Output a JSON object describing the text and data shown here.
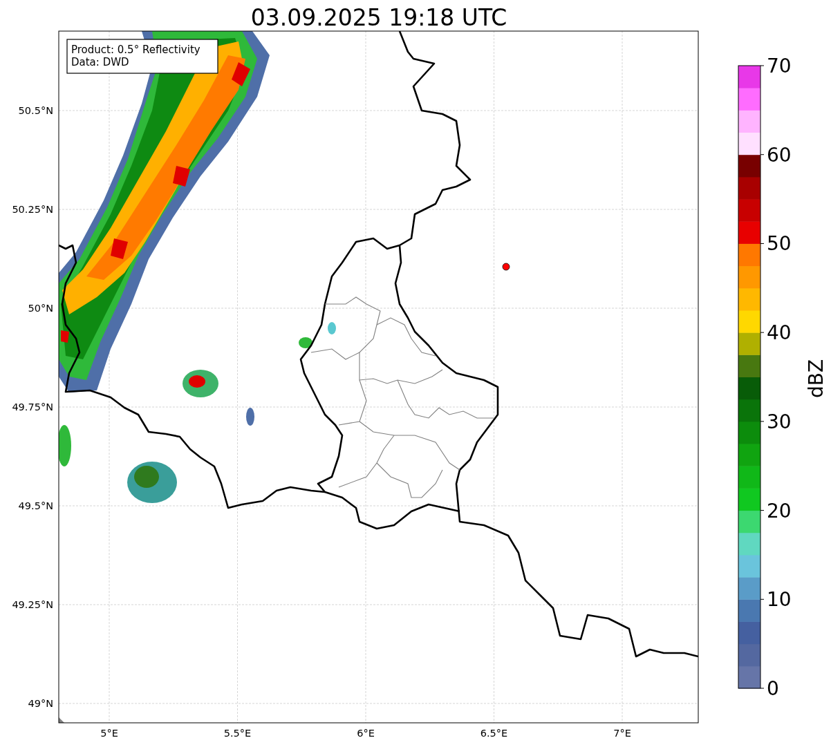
{
  "title": "03.09.2025 19:18 UTC",
  "info_box": [
    "Product: 0.5° Reflectivity",
    "Data: DWD"
  ],
  "y_ticks": [
    "50.5°N",
    "50.25°N",
    "50°N",
    "49.75°N",
    "49.5°N",
    "49.25°N",
    "49°N"
  ],
  "x_ticks": [
    "5°E",
    "5.5°E",
    "6°E",
    "6.5°E",
    "7°E"
  ],
  "colorbar": {
    "label": "dBZ",
    "ticks": [
      "70",
      "60",
      "50",
      "40",
      "30",
      "20",
      "10",
      "0"
    ]
  }
}
